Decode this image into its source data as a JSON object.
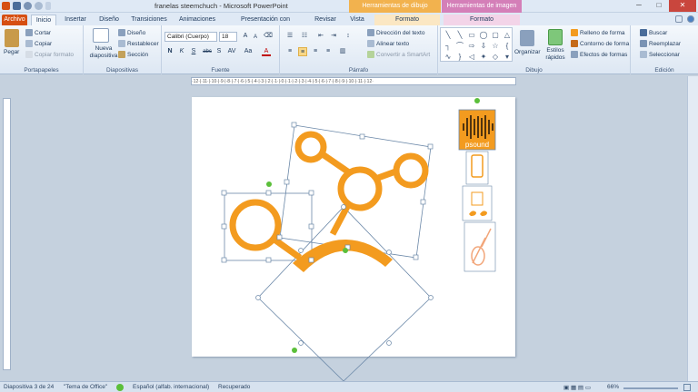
{
  "window": {
    "title": "franelas steemchuch  -  Microsoft PowerPoint",
    "context_draw": "Herramientas de dibujo",
    "context_image": "Herramientas de imagen",
    "minimize": "─",
    "maximize": "□",
    "close": "✕"
  },
  "tabs": [
    "Archivo",
    "Inicio",
    "Insertar",
    "Diseño",
    "Transiciones",
    "Animaciones",
    "Presentación con diapositivas",
    "Revisar",
    "Vista",
    "Formato",
    "Formato"
  ],
  "ribbon": {
    "portapapeles": {
      "paste": "Pegar",
      "cut": "Cortar",
      "copy": "Copiar",
      "copy_format": "Copiar formato",
      "label": "Portapapeles"
    },
    "diapositivas": {
      "new_slide": "Nueva diapositiva",
      "layout": "Diseño",
      "reset": "Restablecer",
      "section": "Sección",
      "label": "Diapositivas"
    },
    "fuente": {
      "font": "Calibri (Cuerpo)",
      "size": "18",
      "label": "Fuente",
      "bold": "N",
      "italic": "K",
      "underline": "S",
      "strike": "abc",
      "shadow": "S",
      "spacing": "AV",
      "case": "Aa",
      "color": "A",
      "grow": "A",
      "shrink": "A"
    },
    "parrafo": {
      "text_dir": "Dirección del texto",
      "align_text": "Alinear texto",
      "smartart": "Convertir a SmartArt",
      "label": "Párrafo"
    },
    "dibujo": {
      "organize": "Organizar",
      "quick_styles": "Estilos rápidos",
      "fill": "Relleno de forma",
      "outline": "Contorno de forma",
      "effects": "Efectos de formas",
      "label": "Dibujo"
    },
    "edicion": {
      "find": "Buscar",
      "replace": "Reemplazar",
      "select": "Seleccionar",
      "label": "Edición"
    }
  },
  "ruler": "·12·|·11·|·10·|·9·|·8·|·7·|·6·|·5·|·4·|·3·|·2·|·1·|·0·|·1·|·2·|·3·|·4·|·5·|·6·|·7·|·8·|·9·|·10·|·11·|·12·",
  "logo_text": "psound",
  "status": {
    "slide": "Diapositiva 3 de 24",
    "theme": "\"Tema de Office\"",
    "language": "Español (alfab. internacional)",
    "recovered": "Recuperado",
    "zoom": "66%"
  },
  "colors": {
    "accent": "#f39b1f",
    "file_tab": "#d64f12",
    "selection": "#6b88a8",
    "handle_green": "#5bbf3a"
  }
}
